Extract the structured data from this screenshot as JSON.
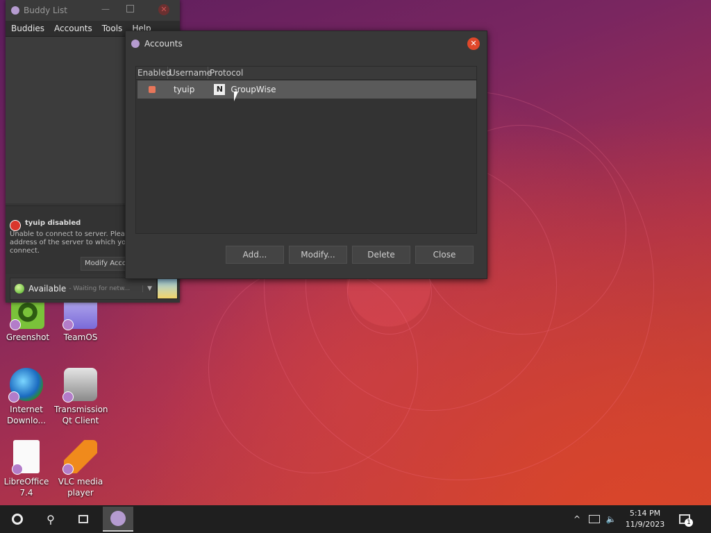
{
  "buddy_list": {
    "title": "Buddy List",
    "menu": [
      "Buddies",
      "Accounts",
      "Tools",
      "Help"
    ],
    "notice_title": "tyuip disabled",
    "notice_lines": [
      "Unable to connect to server. Please",
      "address of the server to which you",
      "connect."
    ],
    "modify_button": "Modify Acco",
    "status_label": "Available",
    "status_sub": "- Waiting for netw..."
  },
  "accounts": {
    "title": "Accounts",
    "columns": [
      "Enabled",
      "Username",
      "Protocol"
    ],
    "rows": [
      {
        "username": "tyuip",
        "protocol": "GroupWise",
        "protocol_icon": "N"
      }
    ],
    "buttons": {
      "add": "Add...",
      "modify": "Modify...",
      "delete": "Delete",
      "close": "Close"
    }
  },
  "desktop_icons": [
    {
      "label": "Greenshot"
    },
    {
      "label": "TeamOS"
    },
    {
      "label": "Internet Downlo..."
    },
    {
      "label": "Transmission Qt Client"
    },
    {
      "label": "LibreOffice 7.4"
    },
    {
      "label": "VLC media player"
    }
  ],
  "taskbar": {
    "time": "5:14 PM",
    "date": "11/9/2023",
    "notification_count": "1"
  },
  "colors": {
    "accent_close": "#e0472a",
    "selected_row": "#5a5a5a"
  }
}
